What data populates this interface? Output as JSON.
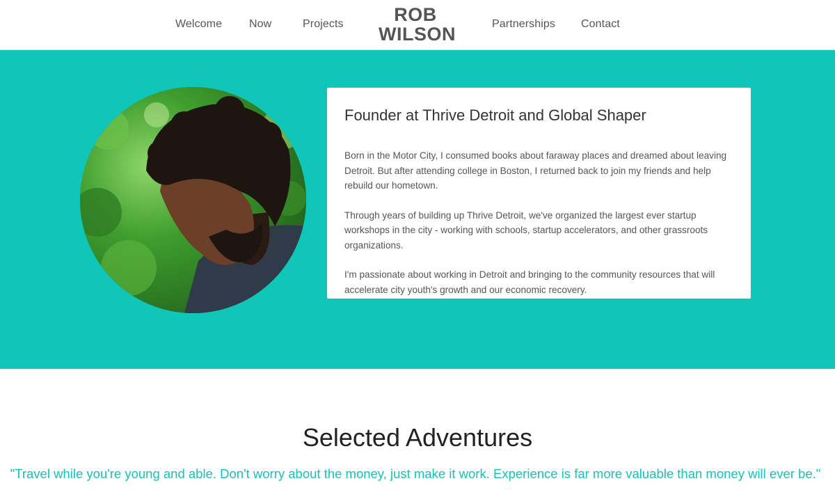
{
  "nav": {
    "welcome": "Welcome",
    "now": "Now",
    "projects": "Projects",
    "logo_line1": "ROB",
    "logo_line2": "WILSON",
    "partnerships": "Partnerships",
    "contact": "Contact"
  },
  "hero": {
    "title": "Founder at Thrive Detroit and Global Shaper",
    "paragraphs": [
      "Born in the Motor City, I consumed books about faraway places and dreamed about leaving Detroit. But after attending college in Boston, I returned back to join my friends and help rebuild our hometown.",
      "Through years of building up Thrive Detroit, we've organized the largest ever startup workshops in the city - working with schools, startup accelerators, and other grassroots organizations.",
      "I'm passionate about working in Detroit and bringing to the community resources that will accelerate city youth's growth and our economic recovery."
    ]
  },
  "adventures": {
    "title": "Selected Adventures",
    "quote": "\"Travel while you're young and able. Don't worry about the money, just make it work. Experience is far more valuable than money will ever be.\""
  },
  "colors": {
    "accent": "#0fc6b8",
    "text": "#555555",
    "heading": "#222222"
  }
}
